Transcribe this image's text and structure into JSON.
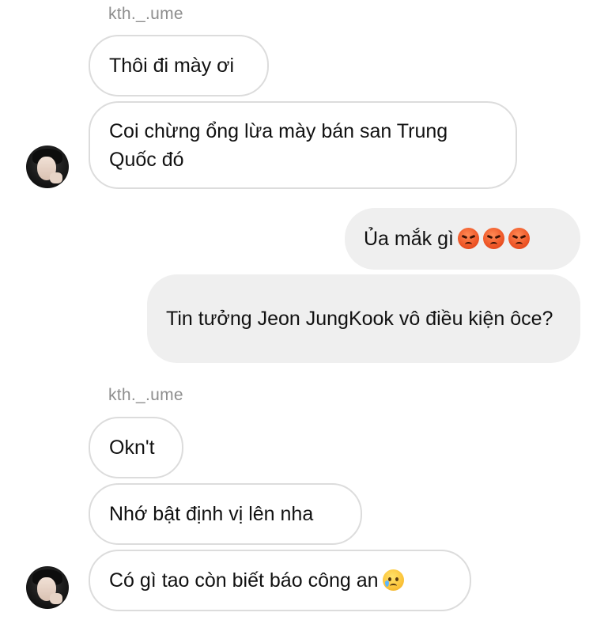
{
  "conversation": {
    "groups": [
      {
        "sender": "kth._.ume",
        "messages": [
          {
            "text": "Thôi đi mày ơi"
          },
          {
            "text": "Coi chừng ổng lừa mày bán san Trung Quốc đó"
          }
        ]
      },
      {
        "sender": "me",
        "messages": [
          {
            "text": "Ủa mắk gì",
            "emojis": [
              "pouting-face-emoji",
              "pouting-face-emoji",
              "pouting-face-emoji"
            ]
          },
          {
            "text": "Tin tưởng Jeon JungKook vô điều kiện ôce?"
          }
        ]
      },
      {
        "sender": "kth._.ume",
        "messages": [
          {
            "text": "Okn't"
          },
          {
            "text": "Nhớ bật định vị lên nha"
          },
          {
            "text": "Có gì tao còn biết báo công an",
            "emojis": [
              "smiling-face-with-tear-emoji"
            ]
          }
        ]
      }
    ]
  },
  "colors": {
    "sent_bubble": "#efefef",
    "received_border": "#dcdcdc",
    "sender_label": "#8e8e8e",
    "text": "#111111"
  }
}
